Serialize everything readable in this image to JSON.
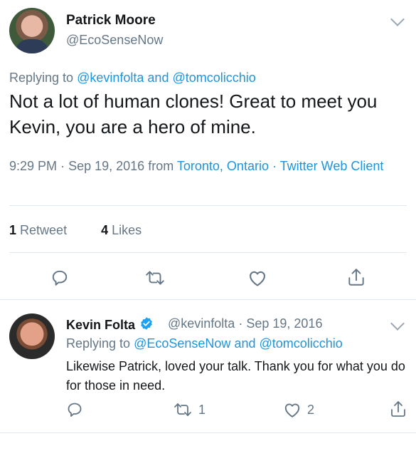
{
  "main_tweet": {
    "name": "Patrick Moore",
    "handle": "@EcoSenseNow",
    "replying_prefix": "Replying to",
    "replying_user1": "@kevinfolta",
    "replying_and": "and",
    "replying_user2": "@tomcolicchio",
    "text": "Not a lot of human clones! Great to meet you Kevin, you are a hero of mine.",
    "time": "9:29 PM",
    "sep1": "·",
    "date": "Sep 19, 2016",
    "from": "from",
    "location": "Toronto, Ontario",
    "sep2": "·",
    "source": "Twitter Web Client",
    "retweet_count": "1",
    "retweet_label": "Retweet",
    "likes_count": "4",
    "likes_label": "Likes"
  },
  "reply_tweet": {
    "name": "Kevin Folta",
    "handle": "@kevinfolta",
    "sep": "·",
    "date": "Sep 19, 2016",
    "replying_prefix": "Replying to",
    "replying_user1": "@EcoSenseNow",
    "replying_and": "and",
    "replying_user2": "@tomcolicchio",
    "text": "Likewise Patrick, loved your talk. Thank you for what you do for those in need.",
    "retweet_count": "1",
    "like_count": "2"
  },
  "icons": {
    "reply": "reply-icon",
    "retweet": "retweet-icon",
    "like": "heart-icon",
    "share": "share-icon",
    "verified": "verified-badge-icon",
    "chevron": "chevron-down-icon"
  },
  "colors": {
    "link": "#1b95e0",
    "muted": "#657786",
    "text": "#14171a",
    "divider": "#e1e8ed"
  }
}
